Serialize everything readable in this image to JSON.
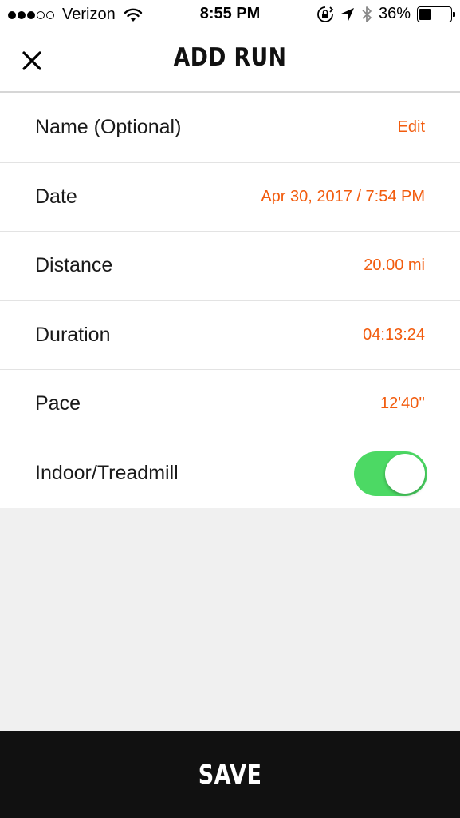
{
  "status_bar": {
    "carrier": "Verizon",
    "signal_bars_filled": 3,
    "signal_bars_total": 5,
    "time": "8:55 PM",
    "battery_percent": "36%",
    "battery_level": 0.36,
    "icons": [
      "wifi-icon",
      "rotation-lock-icon",
      "location-arrow-icon",
      "bluetooth-icon",
      "battery-icon"
    ]
  },
  "header": {
    "title": "ADD RUN",
    "close_icon": "close-icon"
  },
  "form": {
    "rows": [
      {
        "label": "Name (Optional)",
        "value": "Edit"
      },
      {
        "label": "Date",
        "value": "Apr 30, 2017 / 7:54 PM"
      },
      {
        "label": "Distance",
        "value": "20.00 mi"
      },
      {
        "label": "Duration",
        "value": "04:13:24"
      },
      {
        "label": "Pace",
        "value": "12'40''"
      },
      {
        "label": "Indoor/Treadmill",
        "toggle_on": true
      }
    ]
  },
  "footer": {
    "save_label": "SAVE"
  },
  "colors": {
    "accent": "#f25c0e",
    "toggle_on": "#4cd964",
    "save_bar": "#111111",
    "background": "#f0f0f0"
  }
}
